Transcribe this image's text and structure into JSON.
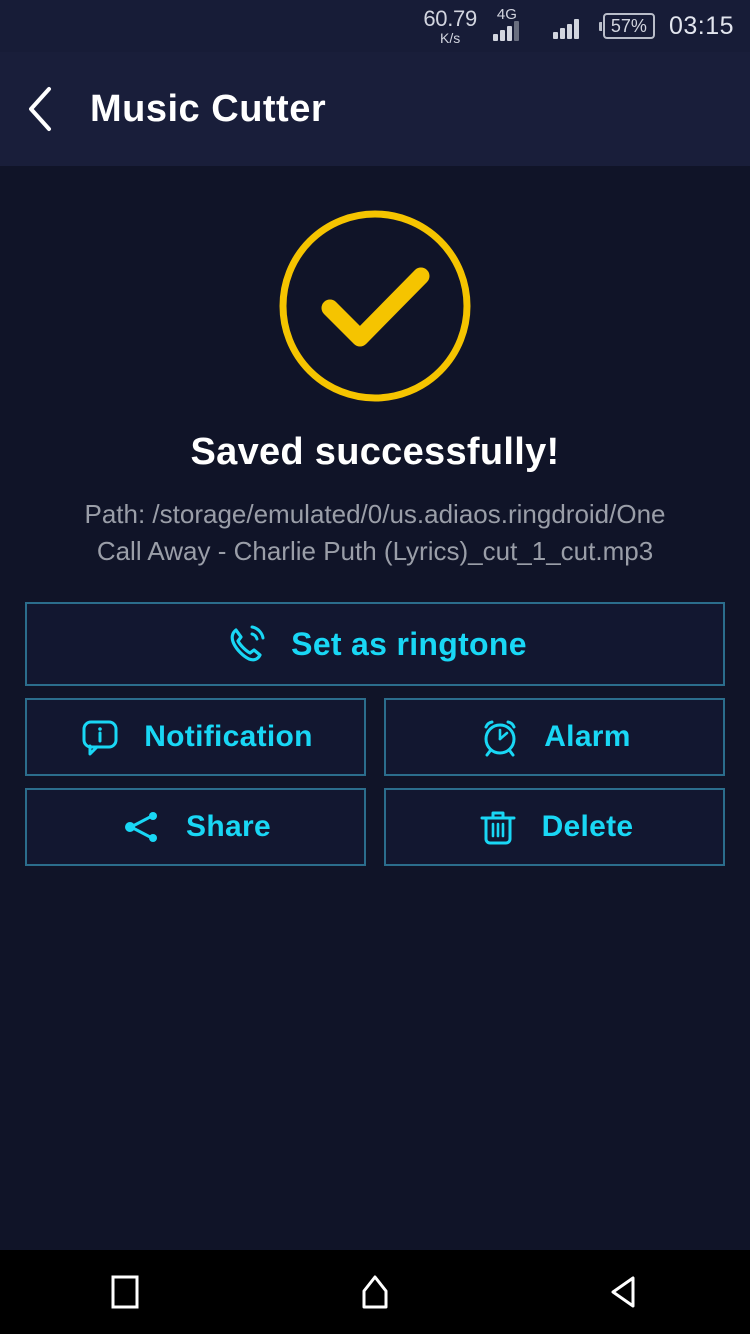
{
  "status_bar": {
    "net_speed_value": "60.79",
    "net_speed_unit": "K/s",
    "network_type": "4G",
    "battery_percent": "57%",
    "clock": "03:15"
  },
  "app_bar": {
    "back_icon": "chevron-left-icon",
    "title": "Music Cutter"
  },
  "result": {
    "status_icon": "check-circle-icon",
    "headline": "Saved successfully!",
    "path": "Path: /storage/emulated/0/us.adiaos.ringdroid/One Call Away - Charlie Puth (Lyrics)_cut_1_cut.mp3"
  },
  "actions": {
    "set_ringtone": {
      "label": "Set as ringtone",
      "icon": "phone-ringing-icon"
    },
    "notification": {
      "label": "Notification",
      "icon": "info-bubble-icon"
    },
    "alarm": {
      "label": "Alarm",
      "icon": "alarm-clock-icon"
    },
    "share": {
      "label": "Share",
      "icon": "share-nodes-icon"
    },
    "delete": {
      "label": "Delete",
      "icon": "trash-icon"
    }
  },
  "nav_bar": {
    "recents_icon": "square-recents-icon",
    "home_icon": "home-icon",
    "back_icon": "back-triangle-icon"
  },
  "colors": {
    "accent_cyan": "#19d7f5",
    "success_yellow": "#f5c400",
    "border_teal": "#2b6d8c",
    "page_bg": "#101428",
    "appbar_bg": "#191e3a",
    "statusbar_bg": "#171c37"
  }
}
